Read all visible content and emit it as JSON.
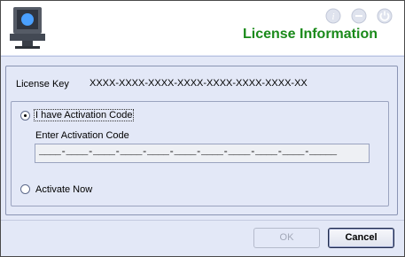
{
  "header": {
    "title": "License Information"
  },
  "license": {
    "label": "License Key",
    "value": "XXXX-XXXX-XXXX-XXXX-XXXX-XXXX-XXXX-XX"
  },
  "activation": {
    "option_have_code": "I have Activation Code",
    "enter_code_label": "Enter Activation Code",
    "code_value": "____-____-____-____-____-____-____-____-____-____-_____",
    "option_activate_now": "Activate Now",
    "selected": "I have Activation Code"
  },
  "buttons": {
    "ok_label": "OK",
    "cancel_label": "Cancel"
  },
  "colors": {
    "title_green": "#1a8a1a",
    "dialog_bg": "#e3e8f7"
  }
}
